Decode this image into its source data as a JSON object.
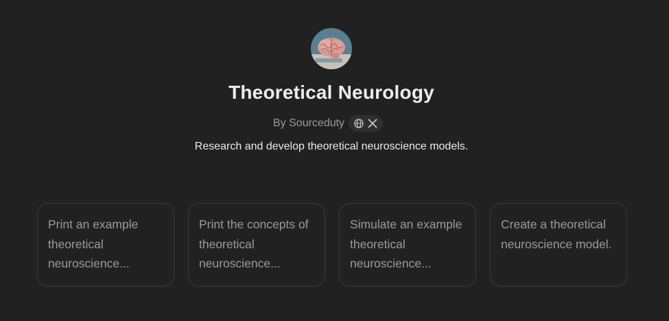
{
  "gpt": {
    "title": "Theoretical Neurology",
    "author": "By Sourceduty",
    "description": "Research and develop theoretical neuroscience models.",
    "avatar_icon": "brain-icon",
    "social_icons": [
      "globe-icon",
      "x-logo-icon"
    ]
  },
  "starters": [
    {
      "label": "Print an example theoretical neuroscience..."
    },
    {
      "label": "Print the concepts of theoretical neuroscience..."
    },
    {
      "label": "Simulate an example theoretical neuroscience..."
    },
    {
      "label": "Create a theoretical neuroscience model."
    }
  ],
  "colors": {
    "background": "#212121",
    "card_border": "#3a3a3a",
    "muted_text": "#9b9b9b",
    "primary_text": "#ececec",
    "pill_background": "#2f2f2f"
  }
}
